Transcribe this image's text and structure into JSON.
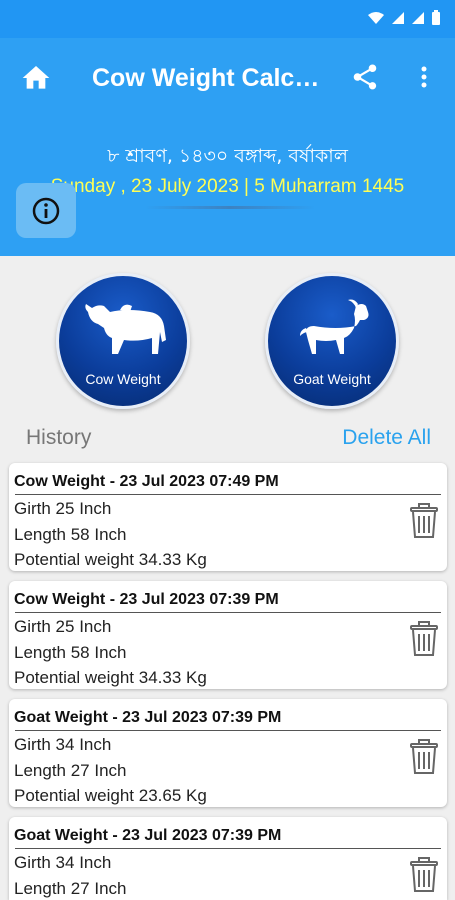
{
  "app": {
    "title": "Cow Weight Calcu…"
  },
  "header": {
    "bangla_date": "৮ শ্রাবণ, ১৪৩০ বঙ্গাব্দ, বর্ষাকাল",
    "english_date": "Sunday , 23 July 2023 | 5 Muharram 1445"
  },
  "buttons": {
    "cow": "Cow Weight",
    "goat": "Goat Weight"
  },
  "history": {
    "label": "History",
    "delete_all": "Delete All",
    "items": [
      {
        "type": "Cow Weight",
        "sep": " - ",
        "datetime": "23 Jul 2023 07:49 PM",
        "girth": "Girth 25  Inch",
        "length": "Length 58  Inch",
        "potential": "Potential weight 34.33 Kg"
      },
      {
        "type": "Cow Weight",
        "sep": " - ",
        "datetime": "23 Jul 2023 07:39 PM",
        "girth": "Girth 25  Inch",
        "length": "Length 58  Inch",
        "potential": "Potential weight 34.33 Kg"
      },
      {
        "type": "Goat Weight",
        "sep": " - ",
        "datetime": "23 Jul 2023 07:39 PM",
        "girth": "Girth 34  Inch",
        "length": "Length 27  Inch",
        "potential": "Potential weight 23.65 Kg"
      },
      {
        "type": "Goat Weight",
        "sep": " - ",
        "datetime": "23 Jul 2023 07:39 PM",
        "girth": "Girth 34  Inch",
        "length": "Length 27  Inch",
        "potential": ""
      }
    ]
  },
  "icons": {
    "home": "home-icon",
    "share": "share-icon",
    "menu": "more-vert-icon",
    "info": "info-icon",
    "delete": "trash-icon"
  },
  "colors": {
    "primary": "#2ea0f3",
    "date_highlight": "#ffff55",
    "accent": "#2aa2ee"
  }
}
